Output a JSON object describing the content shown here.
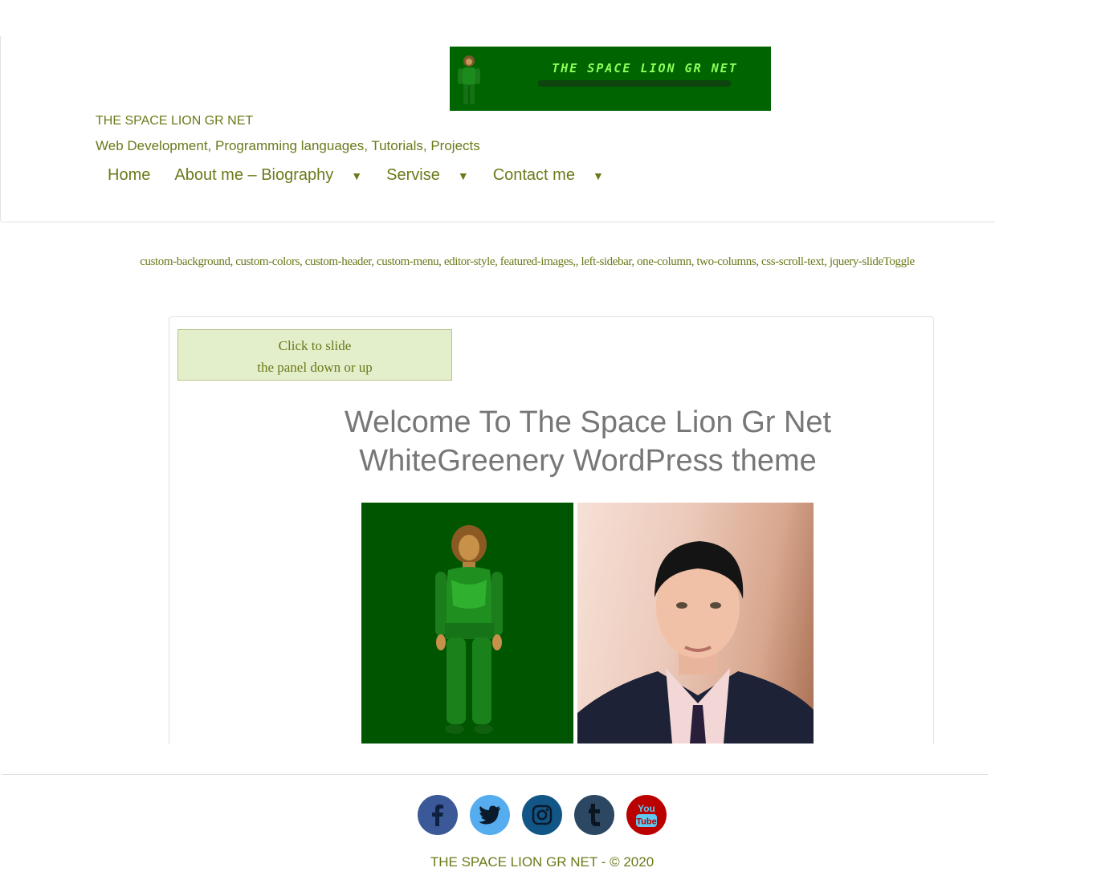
{
  "logo": {
    "text": "THE SPACE LION GR NET"
  },
  "site": {
    "title": "THE SPACE LION GR NET",
    "description": "Web Development, Programming languages, Tutorials, Projects"
  },
  "nav": {
    "items": [
      {
        "label": "Home"
      },
      {
        "label": "About me – Biography",
        "arrow": "▼"
      },
      {
        "label": "Servise",
        "arrow": "▼"
      },
      {
        "label": "Contact me",
        "arrow": "▼"
      }
    ]
  },
  "tags": "custom-background, custom-colors, custom-header, custom-menu, editor-style, featured-images,, left-sidebar, one-column, two-columns, css-scroll-text, jquery-slideToggle",
  "panel": {
    "line1": "Click to slide",
    "line2": "the panel down or up"
  },
  "welcome": {
    "line1": "Welcome To The Space Lion Gr Net",
    "line2": "WhiteGreenery WordPress theme"
  },
  "social": [
    {
      "icon": "facebook-icon",
      "color": "#3b5998"
    },
    {
      "icon": "twitter-icon",
      "color": "#55acee"
    },
    {
      "icon": "instagram-icon",
      "color": "#125688"
    },
    {
      "icon": "tumblr-icon",
      "color": "#2c4762"
    },
    {
      "icon": "youtube-icon",
      "color": "#bb0000",
      "label_top": "You",
      "label_bottom": "Tube"
    }
  ],
  "footer": {
    "copyright": "THE SPACE LION GR NET - © 2020"
  },
  "colors": {
    "accent": "#6b7a1a",
    "heading": "#777777",
    "panel_bg": "#e3eecb",
    "banner_bg": "#006400"
  }
}
